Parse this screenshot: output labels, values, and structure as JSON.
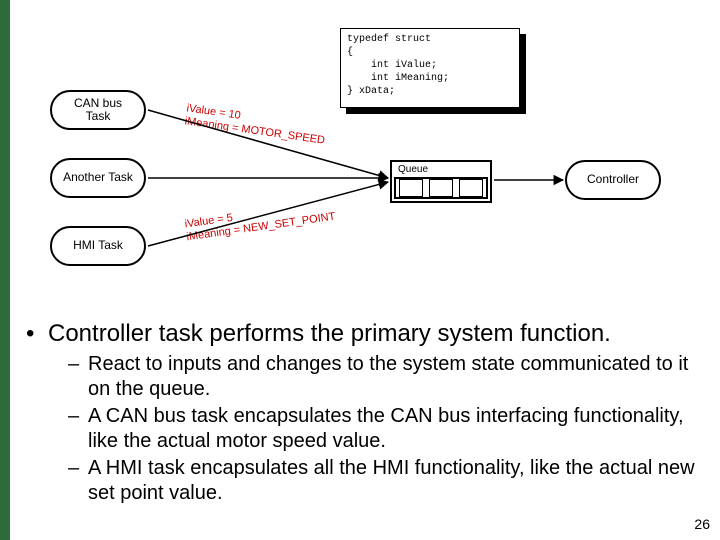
{
  "accent_color": "#2d6b3a",
  "tasks": {
    "can": {
      "label": "CAN bus\nTask"
    },
    "other": {
      "label": "Another Task"
    },
    "hmi": {
      "label": "HMI Task"
    },
    "controller": {
      "label": "Controller"
    }
  },
  "queue": {
    "label": "Queue"
  },
  "code": "typedef struct\n{\n    int iValue;\n    int iMeaning;\n} xData;",
  "edge_labels": {
    "top": {
      "line1": "iValue = 10",
      "line2": "iMeaning = MOTOR_SPEED"
    },
    "bottom": {
      "line1": "iValue = 5",
      "line2": "iMeaning = NEW_SET_POINT"
    }
  },
  "bullets": {
    "main": "Controller task performs the primary system function.",
    "subs": [
      "React to inputs and changes to the system state communicated to it on the queue.",
      "A CAN bus task encapsulates the CAN bus interfacing functionality, like the actual motor speed  value.",
      "A HMI task encapsulates all the HMI functionality, like the actual new set point value."
    ]
  },
  "page_number": "26",
  "chart_data": {
    "type": "diagram",
    "nodes": [
      {
        "id": "can",
        "label": "CAN bus Task"
      },
      {
        "id": "other",
        "label": "Another Task"
      },
      {
        "id": "hmi",
        "label": "HMI Task"
      },
      {
        "id": "queue",
        "label": "Queue"
      },
      {
        "id": "controller",
        "label": "Controller"
      },
      {
        "id": "struct",
        "label": "typedef struct { int iValue; int iMeaning; } xData;"
      }
    ],
    "edges": [
      {
        "from": "can",
        "to": "queue",
        "label": "iValue = 10; iMeaning = MOTOR_SPEED"
      },
      {
        "from": "other",
        "to": "queue",
        "label": ""
      },
      {
        "from": "hmi",
        "to": "queue",
        "label": "iValue = 5; iMeaning = NEW_SET_POINT"
      },
      {
        "from": "queue",
        "to": "controller",
        "label": ""
      }
    ]
  }
}
